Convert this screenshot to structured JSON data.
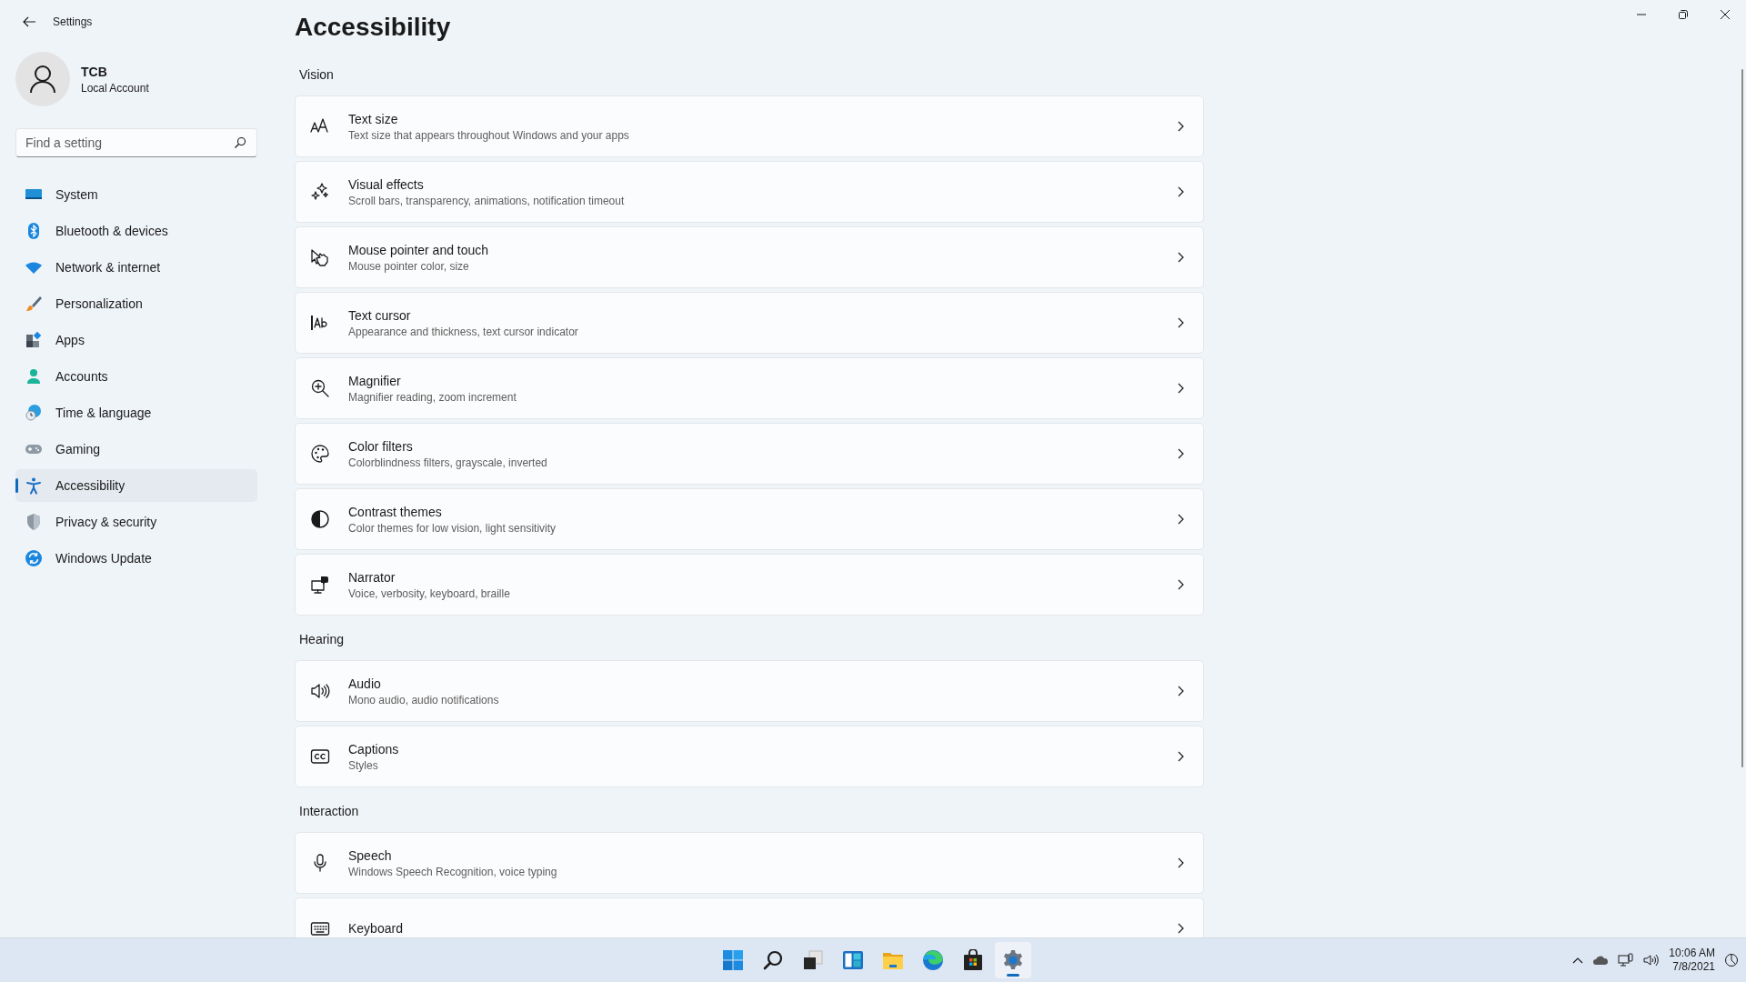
{
  "window": {
    "title": "Settings"
  },
  "account": {
    "name": "TCB",
    "type": "Local Account"
  },
  "search": {
    "placeholder": "Find a setting"
  },
  "nav": [
    {
      "label": "System",
      "selected": false
    },
    {
      "label": "Bluetooth & devices",
      "selected": false
    },
    {
      "label": "Network & internet",
      "selected": false
    },
    {
      "label": "Personalization",
      "selected": false
    },
    {
      "label": "Apps",
      "selected": false
    },
    {
      "label": "Accounts",
      "selected": false
    },
    {
      "label": "Time & language",
      "selected": false
    },
    {
      "label": "Gaming",
      "selected": false
    },
    {
      "label": "Accessibility",
      "selected": true
    },
    {
      "label": "Privacy & security",
      "selected": false
    },
    {
      "label": "Windows Update",
      "selected": false
    }
  ],
  "page": {
    "title": "Accessibility",
    "sections": [
      {
        "heading": "Vision",
        "items": [
          {
            "title": "Text size",
            "subtitle": "Text size that appears throughout Windows and your apps"
          },
          {
            "title": "Visual effects",
            "subtitle": "Scroll bars, transparency, animations, notification timeout"
          },
          {
            "title": "Mouse pointer and touch",
            "subtitle": "Mouse pointer color, size"
          },
          {
            "title": "Text cursor",
            "subtitle": "Appearance and thickness, text cursor indicator"
          },
          {
            "title": "Magnifier",
            "subtitle": "Magnifier reading, zoom increment"
          },
          {
            "title": "Color filters",
            "subtitle": "Colorblindness filters, grayscale, inverted"
          },
          {
            "title": "Contrast themes",
            "subtitle": "Color themes for low vision, light sensitivity"
          },
          {
            "title": "Narrator",
            "subtitle": "Voice, verbosity, keyboard, braille"
          }
        ]
      },
      {
        "heading": "Hearing",
        "items": [
          {
            "title": "Audio",
            "subtitle": "Mono audio, audio notifications"
          },
          {
            "title": "Captions",
            "subtitle": "Styles"
          }
        ]
      },
      {
        "heading": "Interaction",
        "items": [
          {
            "title": "Speech",
            "subtitle": "Windows Speech Recognition, voice typing"
          },
          {
            "title": "Keyboard"
          }
        ]
      }
    ]
  },
  "taskbar": {
    "apps": [
      {
        "selected": false
      },
      {
        "selected": false
      },
      {
        "selected": false
      },
      {
        "selected": false
      },
      {
        "selected": false
      },
      {
        "selected": false
      },
      {
        "selected": false
      },
      {
        "selected": true
      }
    ],
    "time": "10:06 AM",
    "date": "7/8/2021"
  }
}
